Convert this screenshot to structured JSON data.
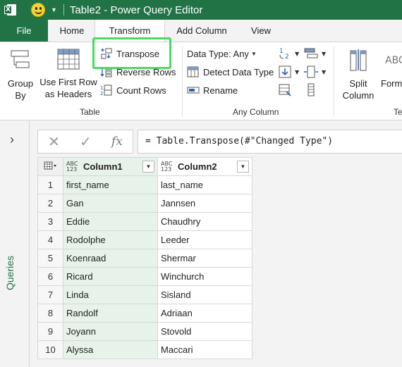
{
  "title_bar": {
    "app_badge": "X",
    "title": "Table2 - Power Query Editor",
    "accent": "#217346"
  },
  "tabs": [
    {
      "label": "File"
    },
    {
      "label": "Home"
    },
    {
      "label": "Transform"
    },
    {
      "label": "Add Column"
    },
    {
      "label": "View"
    }
  ],
  "ribbon": {
    "group_by": "Group\nBy",
    "use_first_row": "Use First Row\nas Headers",
    "transpose": "Transpose",
    "reverse_rows": "Reverse Rows",
    "count_rows": "Count Rows",
    "table_group": "Table",
    "data_type": "Data Type: Any",
    "detect_data_type": "Detect Data Type",
    "rename": "Rename",
    "any_column_group": "Any Column",
    "split_column": "Split\nColumn",
    "format": "Form",
    "text_group_partial": "Te",
    "highlight_color": "#4cd964"
  },
  "queries_pane": {
    "label": "Queries"
  },
  "formula_bar": {
    "fx": "fx",
    "formula": "= Table.Transpose(#\"Changed Type\")"
  },
  "grid": {
    "type_label": "ABC\n123",
    "columns": [
      "Column1",
      "Column2"
    ],
    "rows": [
      {
        "n": "1",
        "c1": "first_name",
        "c2": "last_name"
      },
      {
        "n": "2",
        "c1": "Gan",
        "c2": "Jannsen"
      },
      {
        "n": "3",
        "c1": "Eddie",
        "c2": "Chaudhry"
      },
      {
        "n": "4",
        "c1": "Rodolphe",
        "c2": "Leeder"
      },
      {
        "n": "5",
        "c1": "Koenraad",
        "c2": "Shermar"
      },
      {
        "n": "6",
        "c1": "Ricard",
        "c2": "Winchurch"
      },
      {
        "n": "7",
        "c1": "Linda",
        "c2": "Sisland"
      },
      {
        "n": "8",
        "c1": "Randolf",
        "c2": "Adriaan"
      },
      {
        "n": "9",
        "c1": "Joyann",
        "c2": "Stovold"
      },
      {
        "n": "10",
        "c1": "Alyssa",
        "c2": "Maccari"
      }
    ]
  }
}
